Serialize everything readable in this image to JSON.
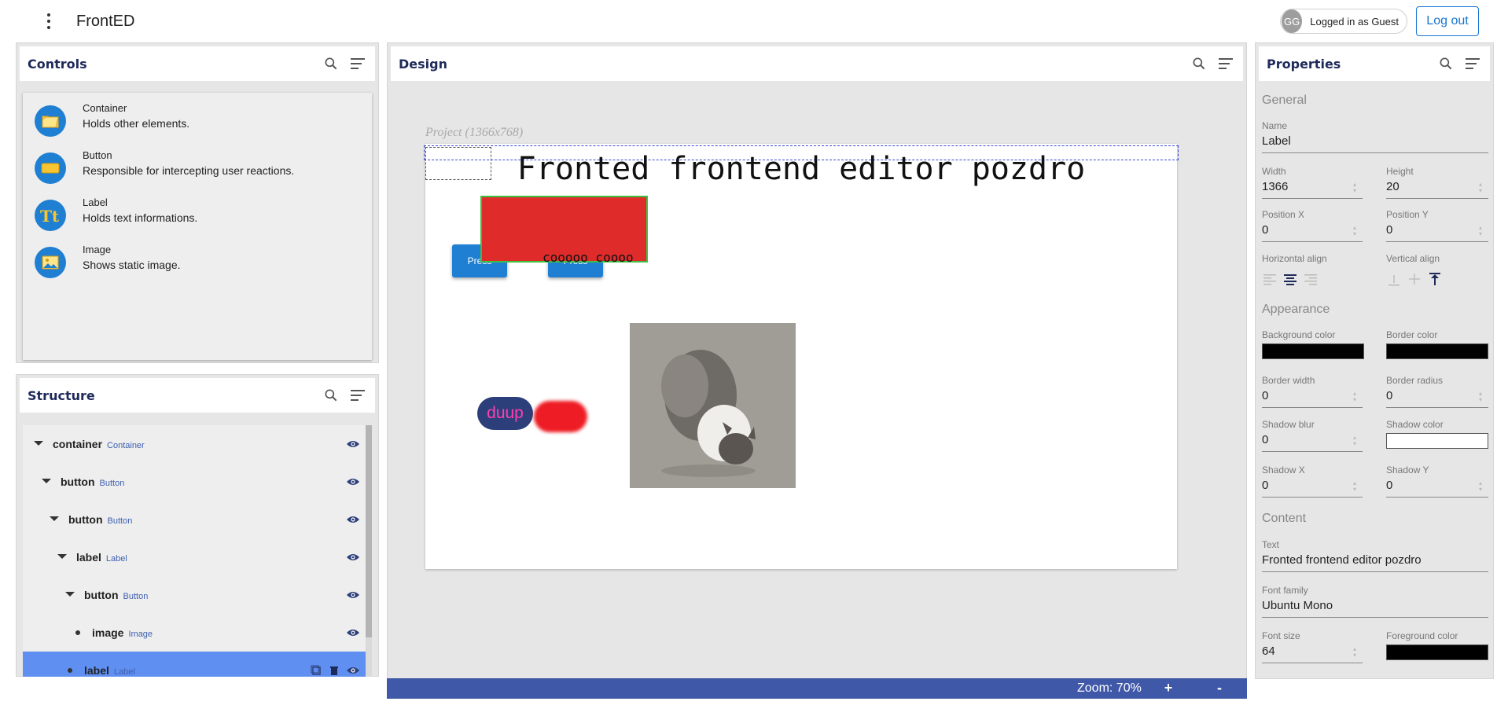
{
  "app": {
    "title": "FrontED",
    "user_initials": "GG",
    "user_label": "Logged in as Guest",
    "logout_label": "Log out"
  },
  "controls": {
    "title": "Controls",
    "items": [
      {
        "name": "Container",
        "desc": "Holds other elements.",
        "icon": "folder-icon"
      },
      {
        "name": "Button",
        "desc": "Responsible for intercepting user reactions.",
        "icon": "button-icon"
      },
      {
        "name": "Label",
        "desc": "Holds text informations.",
        "icon": "text-icon"
      },
      {
        "name": "Image",
        "desc": "Shows static image.",
        "icon": "image-icon"
      }
    ]
  },
  "structure": {
    "title": "Structure",
    "items": [
      {
        "name": "container",
        "type": "Container"
      },
      {
        "name": "button",
        "type": "Button"
      },
      {
        "name": "button",
        "type": "Button"
      },
      {
        "name": "label",
        "type": "Label"
      },
      {
        "name": "button",
        "type": "Button"
      },
      {
        "name": "image",
        "type": "Image"
      },
      {
        "name": "label",
        "type": "Label"
      }
    ]
  },
  "design": {
    "title": "Design",
    "project_label": "Project (1366x768)",
    "heading_text": "Fronted frontend editor pozdro",
    "button1_label": "Press",
    "button2_label": "Press",
    "red_label": "cooooo coooo",
    "pill_label": "duup",
    "zoom_label": "Zoom: 70%",
    "zoom_in": "+",
    "zoom_out": "-"
  },
  "properties": {
    "title": "Properties",
    "general_title": "General",
    "name_label": "Name",
    "name_value": "Label",
    "width_label": "Width",
    "width_value": "1366",
    "height_label": "Height",
    "height_value": "20",
    "posx_label": "Position X",
    "posx_value": "0",
    "posy_label": "Position Y",
    "posy_value": "0",
    "halign_label": "Horizontal align",
    "valign_label": "Vertical align",
    "appearance_title": "Appearance",
    "bg_label": "Background color",
    "bg_color": "#000000",
    "border_color_label": "Border color",
    "border_color": "#000000",
    "border_width_label": "Border width",
    "border_width_value": "0",
    "border_radius_label": "Border radius",
    "border_radius_value": "0",
    "shadow_blur_label": "Shadow blur",
    "shadow_blur_value": "0",
    "shadow_color_label": "Shadow color",
    "shadow_color": "#ffffff",
    "shadow_x_label": "Shadow X",
    "shadow_x_value": "0",
    "shadow_y_label": "Shadow Y",
    "shadow_y_value": "0",
    "content_title": "Content",
    "text_label": "Text",
    "text_value": "Fronted frontend editor pozdro",
    "font_family_label": "Font family",
    "font_family_value": "Ubuntu Mono",
    "font_size_label": "Font size",
    "font_size_value": "64",
    "fg_label": "Foreground color",
    "fg_color": "#000000"
  }
}
